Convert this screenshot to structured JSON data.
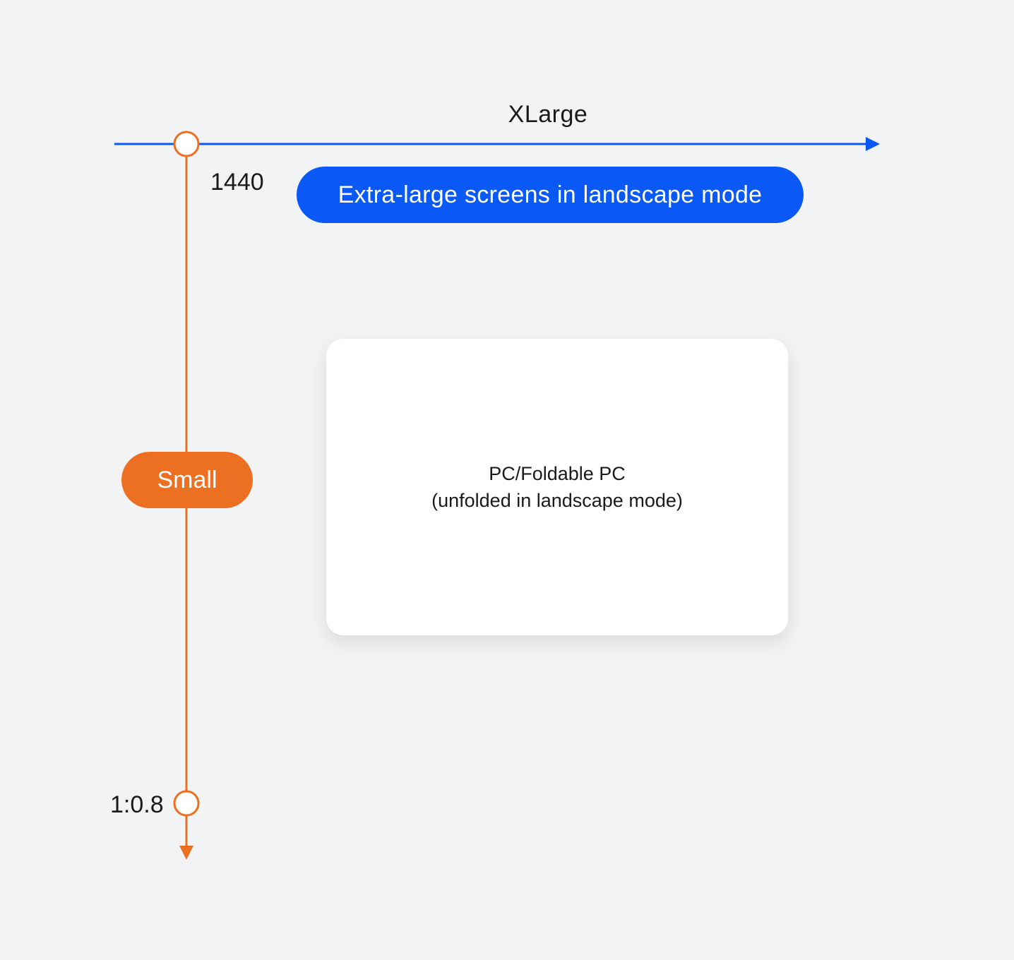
{
  "horizontal_axis": {
    "title": "XLarge",
    "tick_label": "1440",
    "range_label": "Extra-large screens in landscape mode",
    "color": "#0a59f7"
  },
  "vertical_axis": {
    "range_label": "Small",
    "tick_label": "1:0.8",
    "color": "#ed6f21"
  },
  "device": {
    "line1": "PC/Foldable PC",
    "line2": "(unfolded in landscape mode)"
  }
}
